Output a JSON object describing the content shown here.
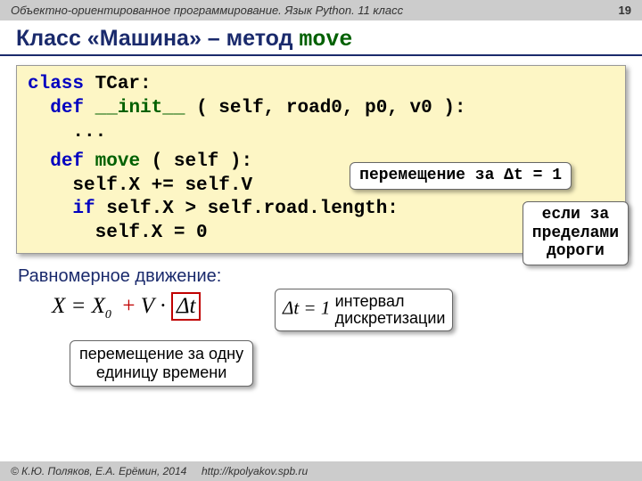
{
  "header": {
    "course": "Объектно-ориентированное программирование. Язык Python. 11 класс",
    "page": "19"
  },
  "title": {
    "prefix": "Класс «Машина» – метод ",
    "method": "move"
  },
  "code": {
    "l1a": "class",
    "l1b": " TCar:",
    "l2a": "def",
    "l2b": "__init__",
    "l2c": " ( self, road0, p0, v0 ):",
    "l3": "...",
    "l4a": "def",
    "l4b": "move",
    "l4c": " ( self ):",
    "l5": "self.X += self.V",
    "l6a": "if",
    "l6b": " self.X > self.road.length:",
    "l7": "self.X = 0"
  },
  "callouts": {
    "c1": "перемещение за Δt = 1",
    "c2": "если за\nпределами\nдороги",
    "c3": "интервал\nдискретизации",
    "c4": "перемещение за одну\nединицу времени"
  },
  "subhead": "Равномерное движение:",
  "formula": {
    "lhs": "X = X",
    "sub0": "0",
    "mid": " ",
    "V": "V",
    "dot": "·",
    "dt": "Δt"
  },
  "dt_eq": {
    "lhs": "Δt",
    "eq": " = 1"
  },
  "footer": {
    "copyright": "© К.Ю. Поляков, Е.А. Ерёмин, 2014",
    "url": "http://kpolyakov.spb.ru"
  }
}
